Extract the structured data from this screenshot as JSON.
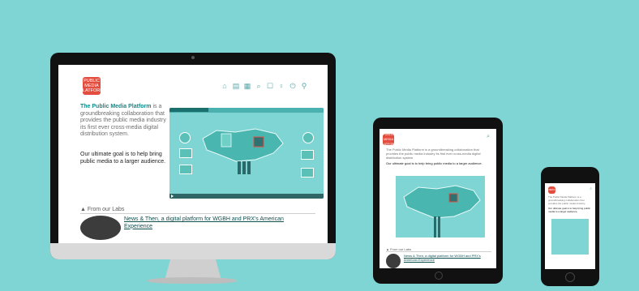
{
  "logo": {
    "text": "PUBLIC MEDIA PLATFORM"
  },
  "desktop": {
    "nav_icons": [
      "home-icon",
      "tv-icon",
      "radio-icon",
      "search-icon",
      "document-icon",
      "lightbulb-icon",
      "power-icon",
      "user-icon"
    ],
    "intro": {
      "highlight": "The Public Media Platform",
      "rest": "is a groundbreaking collaboration that provides the public media industry its first ever cross-media digital distribution system."
    },
    "goal": "Our ultimate goal is to help bring public media to a larger audience.",
    "from_label": "From our Labs",
    "article_title": "News & Then, a digital platform for WGBH and PRX's American Experience"
  },
  "tablet": {
    "intro": "The Public Media Platform is a groundbreaking collaboration that provides the public media industry its first ever cross-media digital distribution system.",
    "goal": "Our ultimate goal is to help bring public media to a larger audience.",
    "from_label": "From our Labs",
    "article_title": "News & Then, a digital platform for WGBH and PRX's American Experience"
  },
  "phone": {
    "intro": "The Public Media Platform is a groundbreaking collaboration that provides the public media industry.",
    "goal": "Our ultimate goal is to help bring public media to a larger audience."
  },
  "colors": {
    "background": "#7fd4d4",
    "accent": "#e24d3f",
    "teal": "#0f8b8b"
  }
}
